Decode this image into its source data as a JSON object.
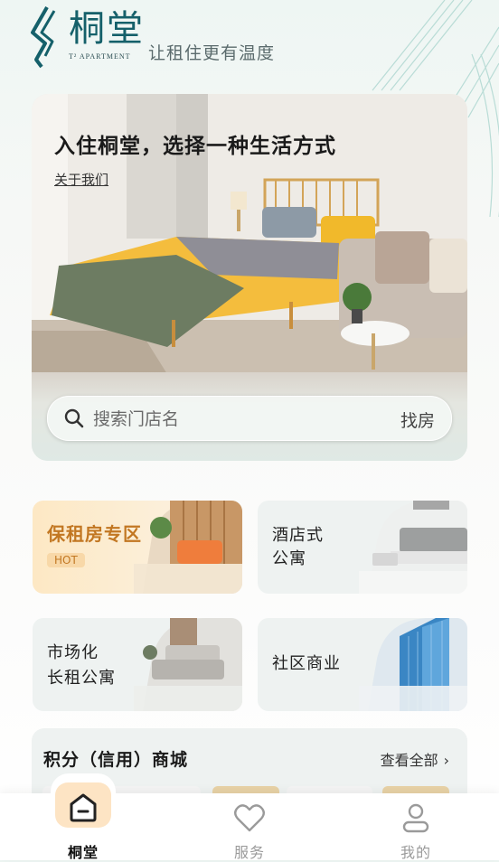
{
  "header": {
    "brand_name": "桐堂",
    "brand_sub": "T² APARTMENT",
    "slogan": "让租住更有温度"
  },
  "hero": {
    "title": "入住桐堂，选择一种生活方式",
    "link": "关于我们"
  },
  "search": {
    "placeholder": "搜索门店名",
    "button": "找房"
  },
  "cards": [
    {
      "label": "保租房专区",
      "badge": "HOT"
    },
    {
      "line1": "酒店式",
      "line2": "公寓"
    },
    {
      "line1": "市场化",
      "line2": "长租公寓"
    },
    {
      "label": "社区商业"
    }
  ],
  "mall": {
    "title": "积分（信用）商城",
    "more": "查看全部"
  },
  "tabs": [
    {
      "label": "桐堂",
      "icon": "home-icon",
      "active": true
    },
    {
      "label": "服务",
      "icon": "heart-icon",
      "active": false
    },
    {
      "label": "我的",
      "icon": "user-icon",
      "active": false
    }
  ],
  "colors": {
    "brand": "#15606a",
    "accent": "#c27722",
    "active_tab_bg": "#fde4c4"
  }
}
